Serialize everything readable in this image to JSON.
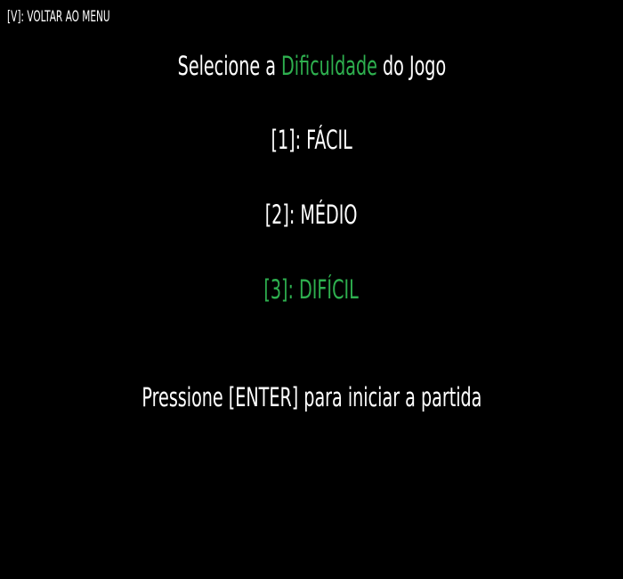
{
  "back_hint": "[V]: VOLTAR AO MENU",
  "title": {
    "prefix": "Selecione a",
    "highlight": "Dificuldade",
    "suffix": "do Jogo"
  },
  "options": [
    {
      "label": "[1]: FÁCIL",
      "selected": false
    },
    {
      "label": "[2]: MÉDIO",
      "selected": false
    },
    {
      "label": "[3]: DIFÍCIL",
      "selected": true
    }
  ],
  "start_prompt": "Pressione [ENTER] para iniciar a partida",
  "colors": {
    "background": "#000000",
    "text": "#ffffff",
    "accent": "#2eb04f"
  }
}
